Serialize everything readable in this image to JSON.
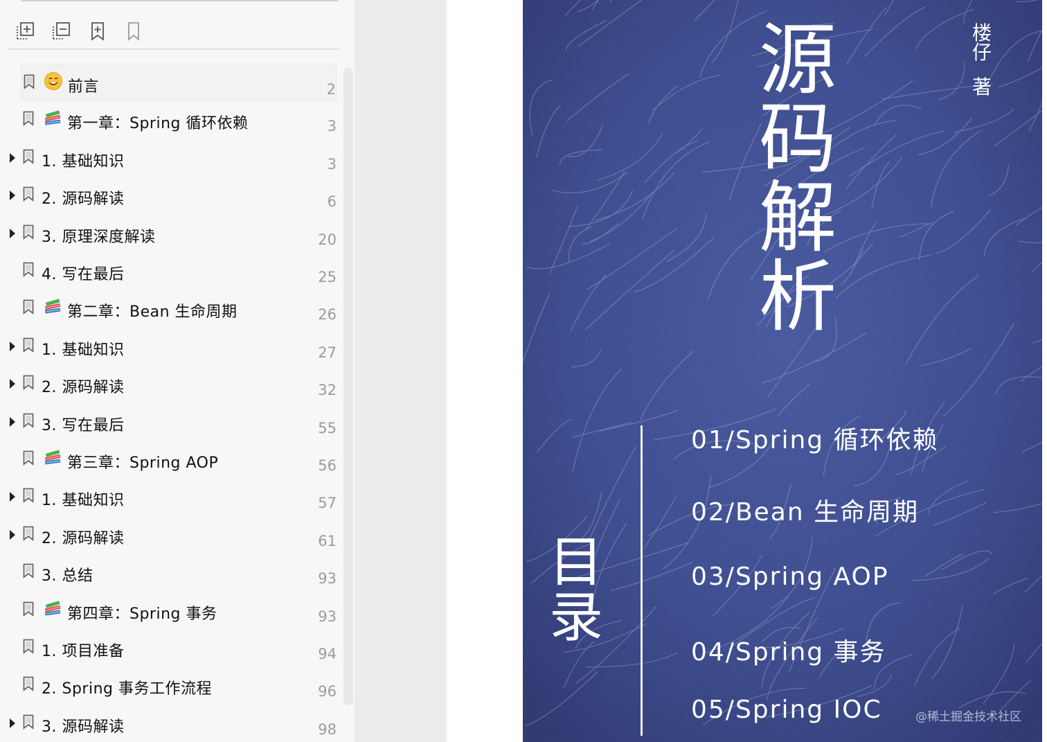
{
  "toolbar": {
    "buttons": [
      "expand-all",
      "collapse-all",
      "add-bookmark",
      "bookmark"
    ]
  },
  "outline": [
    {
      "title": "前言",
      "page": "2",
      "level": 0,
      "icon": "smile-emoji",
      "expandable": false,
      "selected": true
    },
    {
      "title": "第一章：Spring 循环依赖",
      "page": "3",
      "level": 0,
      "icon": "books-emoji",
      "expandable": false
    },
    {
      "title": "1. 基础知识",
      "page": "3",
      "level": 0,
      "expandable": true
    },
    {
      "title": "2. 源码解读",
      "page": "6",
      "level": 0,
      "expandable": true
    },
    {
      "title": "3. 原理深度解读",
      "page": "20",
      "level": 0,
      "expandable": true
    },
    {
      "title": "4. 写在最后",
      "page": "25",
      "level": 0,
      "expandable": false
    },
    {
      "title": "第二章：Bean 生命周期",
      "page": "26",
      "level": 0,
      "icon": "books-emoji",
      "expandable": false
    },
    {
      "title": "1. 基础知识",
      "page": "27",
      "level": 0,
      "expandable": true
    },
    {
      "title": "2. 源码解读",
      "page": "32",
      "level": 0,
      "expandable": true
    },
    {
      "title": "3. 写在最后",
      "page": "55",
      "level": 0,
      "expandable": true
    },
    {
      "title": "第三章：Spring AOP",
      "page": "56",
      "level": 0,
      "icon": "books-emoji",
      "expandable": false
    },
    {
      "title": "1. 基础知识",
      "page": "57",
      "level": 0,
      "expandable": true
    },
    {
      "title": "2. 源码解读",
      "page": "61",
      "level": 0,
      "expandable": true
    },
    {
      "title": "3. 总结",
      "page": "93",
      "level": 0,
      "expandable": false
    },
    {
      "title": "第四章：Spring 事务",
      "page": "93",
      "level": 0,
      "icon": "books-emoji",
      "expandable": false
    },
    {
      "title": "1. 项目准备",
      "page": "94",
      "level": 0,
      "expandable": false
    },
    {
      "title": "2. Spring 事务工作流程",
      "page": "96",
      "level": 0,
      "expandable": false
    },
    {
      "title": "3. 源码解读",
      "page": "98",
      "level": 0,
      "expandable": true
    }
  ],
  "cover": {
    "title_chars": [
      "源",
      "码",
      "解",
      "析"
    ],
    "author_chars": [
      "楼",
      "仔",
      "著"
    ],
    "toc_label_chars": [
      "目",
      "录"
    ],
    "toc": [
      "01/Spring 循环依赖",
      "02/Bean 生命周期",
      "03/Spring AOP",
      "04/Spring 事务",
      "05/Spring IOC"
    ],
    "watermark": "@稀土掘金技术社区",
    "background_color": "#2f3f86"
  }
}
